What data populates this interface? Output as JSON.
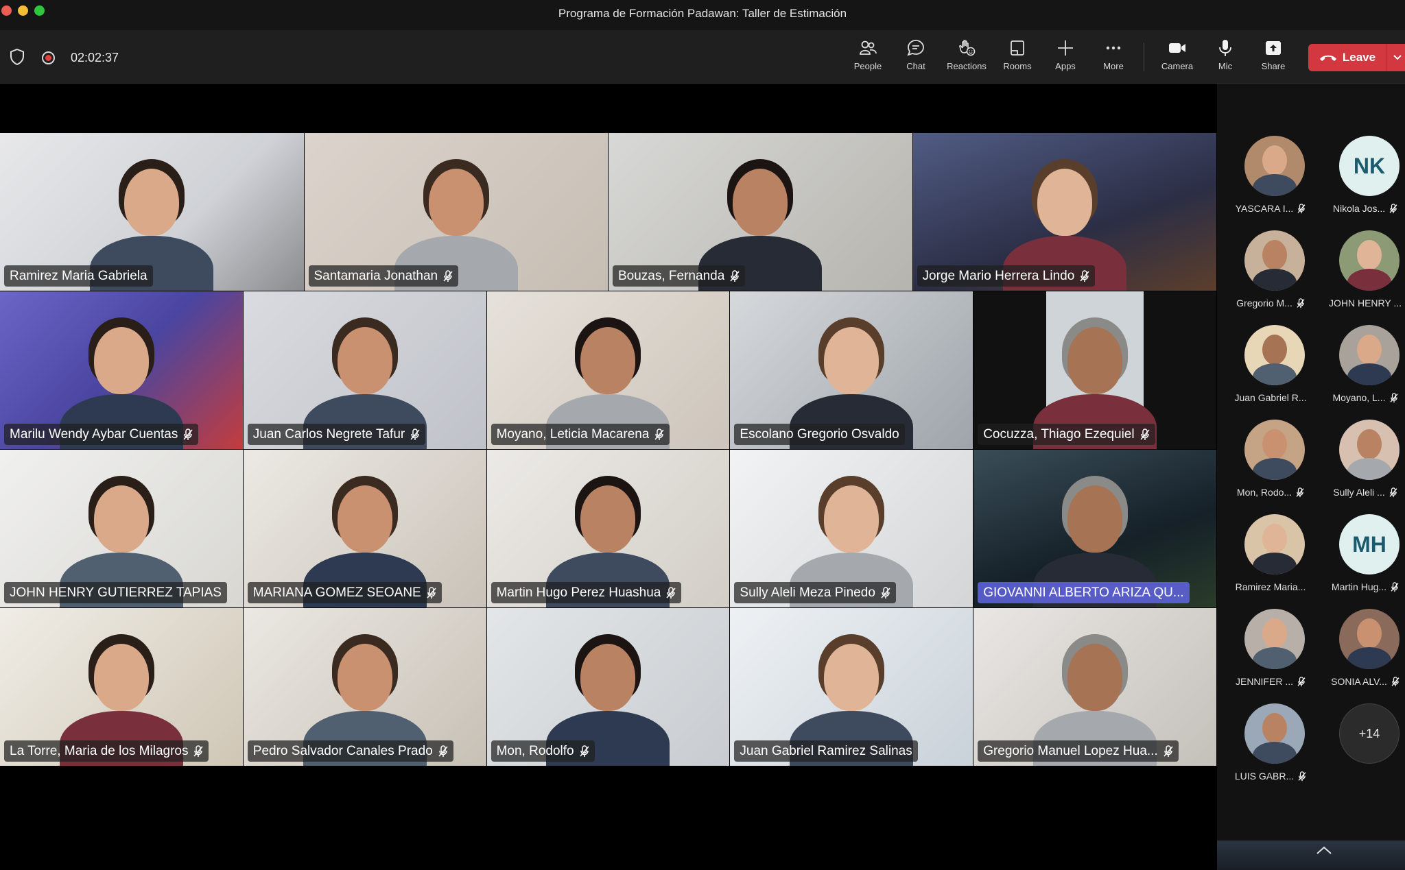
{
  "window": {
    "title": "Programa de Formación Padawan: Taller de Estimación"
  },
  "toolbar": {
    "timer": "02:02:37",
    "buttons": [
      {
        "label": "People",
        "icon": "people-icon"
      },
      {
        "label": "Chat",
        "icon": "chat-icon"
      },
      {
        "label": "Reactions",
        "icon": "reactions-icon"
      },
      {
        "label": "Rooms",
        "icon": "rooms-icon"
      },
      {
        "label": "Apps",
        "icon": "apps-icon"
      },
      {
        "label": "More",
        "icon": "more-icon"
      },
      {
        "label": "Camera",
        "icon": "camera-icon"
      },
      {
        "label": "Mic",
        "icon": "mic-icon"
      },
      {
        "label": "Share",
        "icon": "share-icon"
      }
    ],
    "leave_label": "Leave",
    "leave_color": "#d3373f"
  },
  "grid": {
    "rows": [
      [
        {
          "name": "Ramirez Maria Gabriela",
          "muted": false
        },
        {
          "name": "Santamaria Jonathan",
          "muted": true
        },
        {
          "name": "Bouzas, Fernanda",
          "muted": true
        },
        {
          "name": "Jorge Mario Herrera Lindo",
          "muted": true
        }
      ],
      [
        {
          "name": "Marilu Wendy Aybar Cuentas",
          "muted": true
        },
        {
          "name": "Juan Carlos Negrete Tafur",
          "muted": true
        },
        {
          "name": "Moyano, Leticia Macarena",
          "muted": true
        },
        {
          "name": "Escolano Gregorio Osvaldo",
          "muted": false
        },
        {
          "name": "Cocuzza, Thiago Ezequiel",
          "muted": true
        }
      ],
      [
        {
          "name": "JOHN HENRY GUTIERREZ TAPIAS",
          "muted": false
        },
        {
          "name": "MARIANA GOMEZ SEOANE",
          "muted": true
        },
        {
          "name": "Martin Hugo Perez Huashua",
          "muted": true
        },
        {
          "name": "Sully Aleli Meza Pinedo",
          "muted": true
        },
        {
          "name": "GIOVANNI ALBERTO ARIZA QU...",
          "muted": false,
          "active": true
        }
      ],
      [
        {
          "name": "La Torre, Maria de los Milagros",
          "muted": true
        },
        {
          "name": "Pedro Salvador Canales Prado",
          "muted": true
        },
        {
          "name": "Mon, Rodolfo",
          "muted": true
        },
        {
          "name": "Juan Gabriel Ramirez Salinas",
          "muted": false
        },
        {
          "name": "Gregorio Manuel Lopez Hua...",
          "muted": true
        }
      ]
    ]
  },
  "sidebar": {
    "participants": [
      {
        "label": "YASCARA I...",
        "muted": true
      },
      {
        "label": "Nikola Jos...",
        "muted": true,
        "initials": "NK"
      },
      {
        "label": "Gregorio M...",
        "muted": true
      },
      {
        "label": "JOHN HENRY ...",
        "muted": false
      },
      {
        "label": "Juan Gabriel R...",
        "muted": false
      },
      {
        "label": "Moyano, L...",
        "muted": true
      },
      {
        "label": "Mon, Rodo...",
        "muted": true
      },
      {
        "label": "Sully Aleli ...",
        "muted": true
      },
      {
        "label": "Ramirez Maria...",
        "muted": false
      },
      {
        "label": "Martin Hug...",
        "muted": true,
        "initials": "MH"
      },
      {
        "label": "JENNIFER ...",
        "muted": true
      },
      {
        "label": "SONIA ALV...",
        "muted": true
      },
      {
        "label": "LUIS GABR...",
        "muted": true
      }
    ],
    "more_count": "+14"
  }
}
